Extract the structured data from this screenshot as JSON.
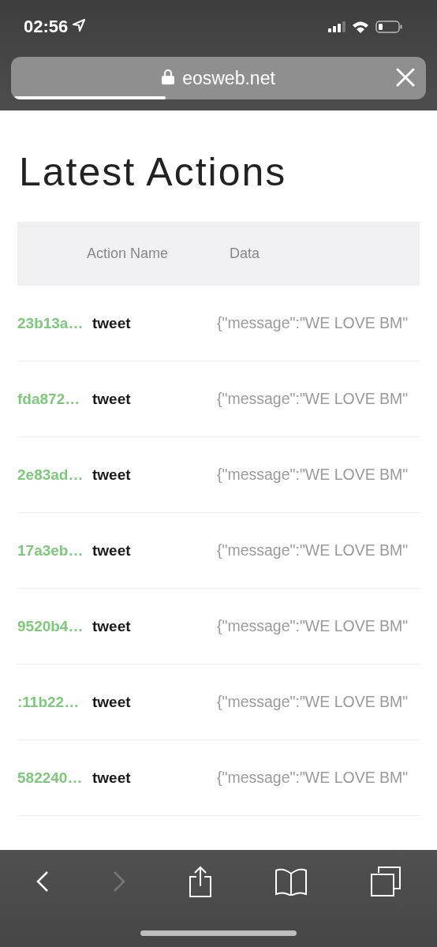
{
  "status_bar": {
    "time": "02:56"
  },
  "address_bar": {
    "url": "eosweb.net",
    "level": 0.37
  },
  "page": {
    "title": "Latest Actions"
  },
  "table": {
    "columns": [
      "Action Name",
      "Data"
    ],
    "rows": [
      {
        "column_1": "23b13a…",
        "action_name": "tweet",
        "data": "{\"message\":\"WE LOVE BM\""
      },
      {
        "column_1": "fda872…",
        "action_name": "tweet",
        "data": "{\"message\":\"WE LOVE BM\""
      },
      {
        "column_1": "2e83ad…",
        "action_name": "tweet",
        "data": "{\"message\":\"WE LOVE BM\""
      },
      {
        "column_1": "17a3eb…",
        "action_name": "tweet",
        "data": "{\"message\":\"WE LOVE BM\""
      },
      {
        "column_1": "9520b4…",
        "action_name": "tweet",
        "data": "{\"message\":\"WE LOVE BM\""
      },
      {
        "column_1": ":11b22…",
        "action_name": "tweet",
        "data": "{\"message\":\"WE LOVE BM\""
      },
      {
        "column_1": "582240…",
        "action_name": "tweet",
        "data": "{\"message\":\"WE LOVE BM\""
      }
    ]
  },
  "toolbar": [
    {
      "kind": "back",
      "disabled": false
    },
    {
      "kind": "forward",
      "disabled": true
    },
    {
      "kind": "share",
      "disabled": false
    },
    {
      "kind": "bookmarks",
      "disabled": false
    },
    {
      "kind": "tabs",
      "disabled": false
    }
  ]
}
